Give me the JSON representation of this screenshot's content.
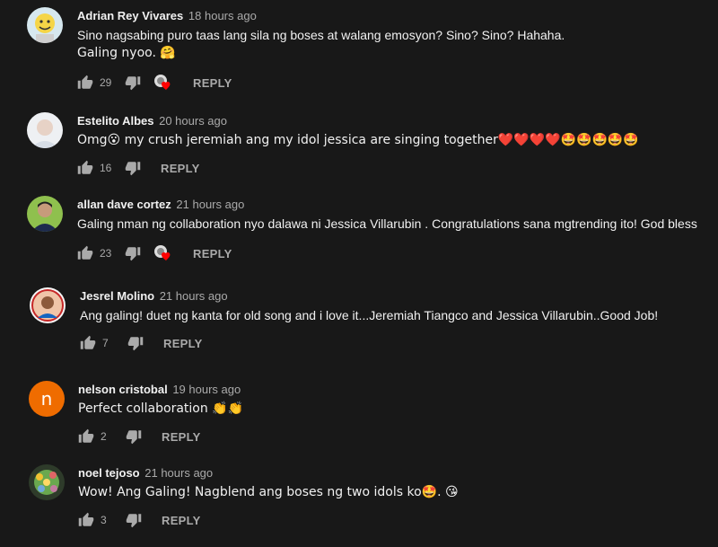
{
  "reply_label": "REPLY",
  "colors": {
    "background": "#181818",
    "text": "#f1f1f1",
    "muted": "#aaaaaa",
    "heart": "#ff0000",
    "avatar_n": "#ef6c00"
  },
  "comments": [
    {
      "author": "Adrian Rey Vivares",
      "time": "18 hours ago",
      "text": "Sino nagsabing puro taas lang sila ng boses at walang emosyon? Sino? Sino? Hahaha.",
      "text2": "Galing nyoo. 🤗",
      "likes": "29",
      "hearted": true,
      "avatar": "avatar-adrian"
    },
    {
      "author": "Estelito Albes",
      "time": "20 hours ago",
      "text": "Omg😮 my crush jeremiah ang my idol jessica are singing together❤️❤️❤️❤️🤩🤩🤩🤩🤩",
      "likes": "16",
      "hearted": false,
      "avatar": "avatar-estelito"
    },
    {
      "author": "allan dave cortez",
      "time": "21 hours ago",
      "text": "Galing nman ng collaboration nyo dalawa ni Jessica Villarubin . Congratulations sana mgtrending ito! God bless",
      "likes": "23",
      "hearted": true,
      "avatar": "avatar-allan"
    },
    {
      "author": "Jesrel Molino",
      "time": "21 hours ago",
      "text": "Ang galing! duet ng kanta for old song and i love it...Jeremiah Tiangco and Jessica Villarubin..Good Job!",
      "likes": "7",
      "hearted": false,
      "avatar": "avatar-jesrel"
    },
    {
      "author": "nelson cristobal",
      "time": "19 hours ago",
      "text": "Perfect collaboration 👏👏",
      "likes": "2",
      "hearted": false,
      "avatar": "avatar-nelson",
      "avatar_letter": "n"
    },
    {
      "author": "noel tejoso",
      "time": "21 hours ago",
      "text": "Wow! Ang Galing! Nagblend ang boses ng two idols ko🤩. 😘",
      "likes": "3",
      "hearted": false,
      "avatar": "avatar-noel"
    }
  ]
}
